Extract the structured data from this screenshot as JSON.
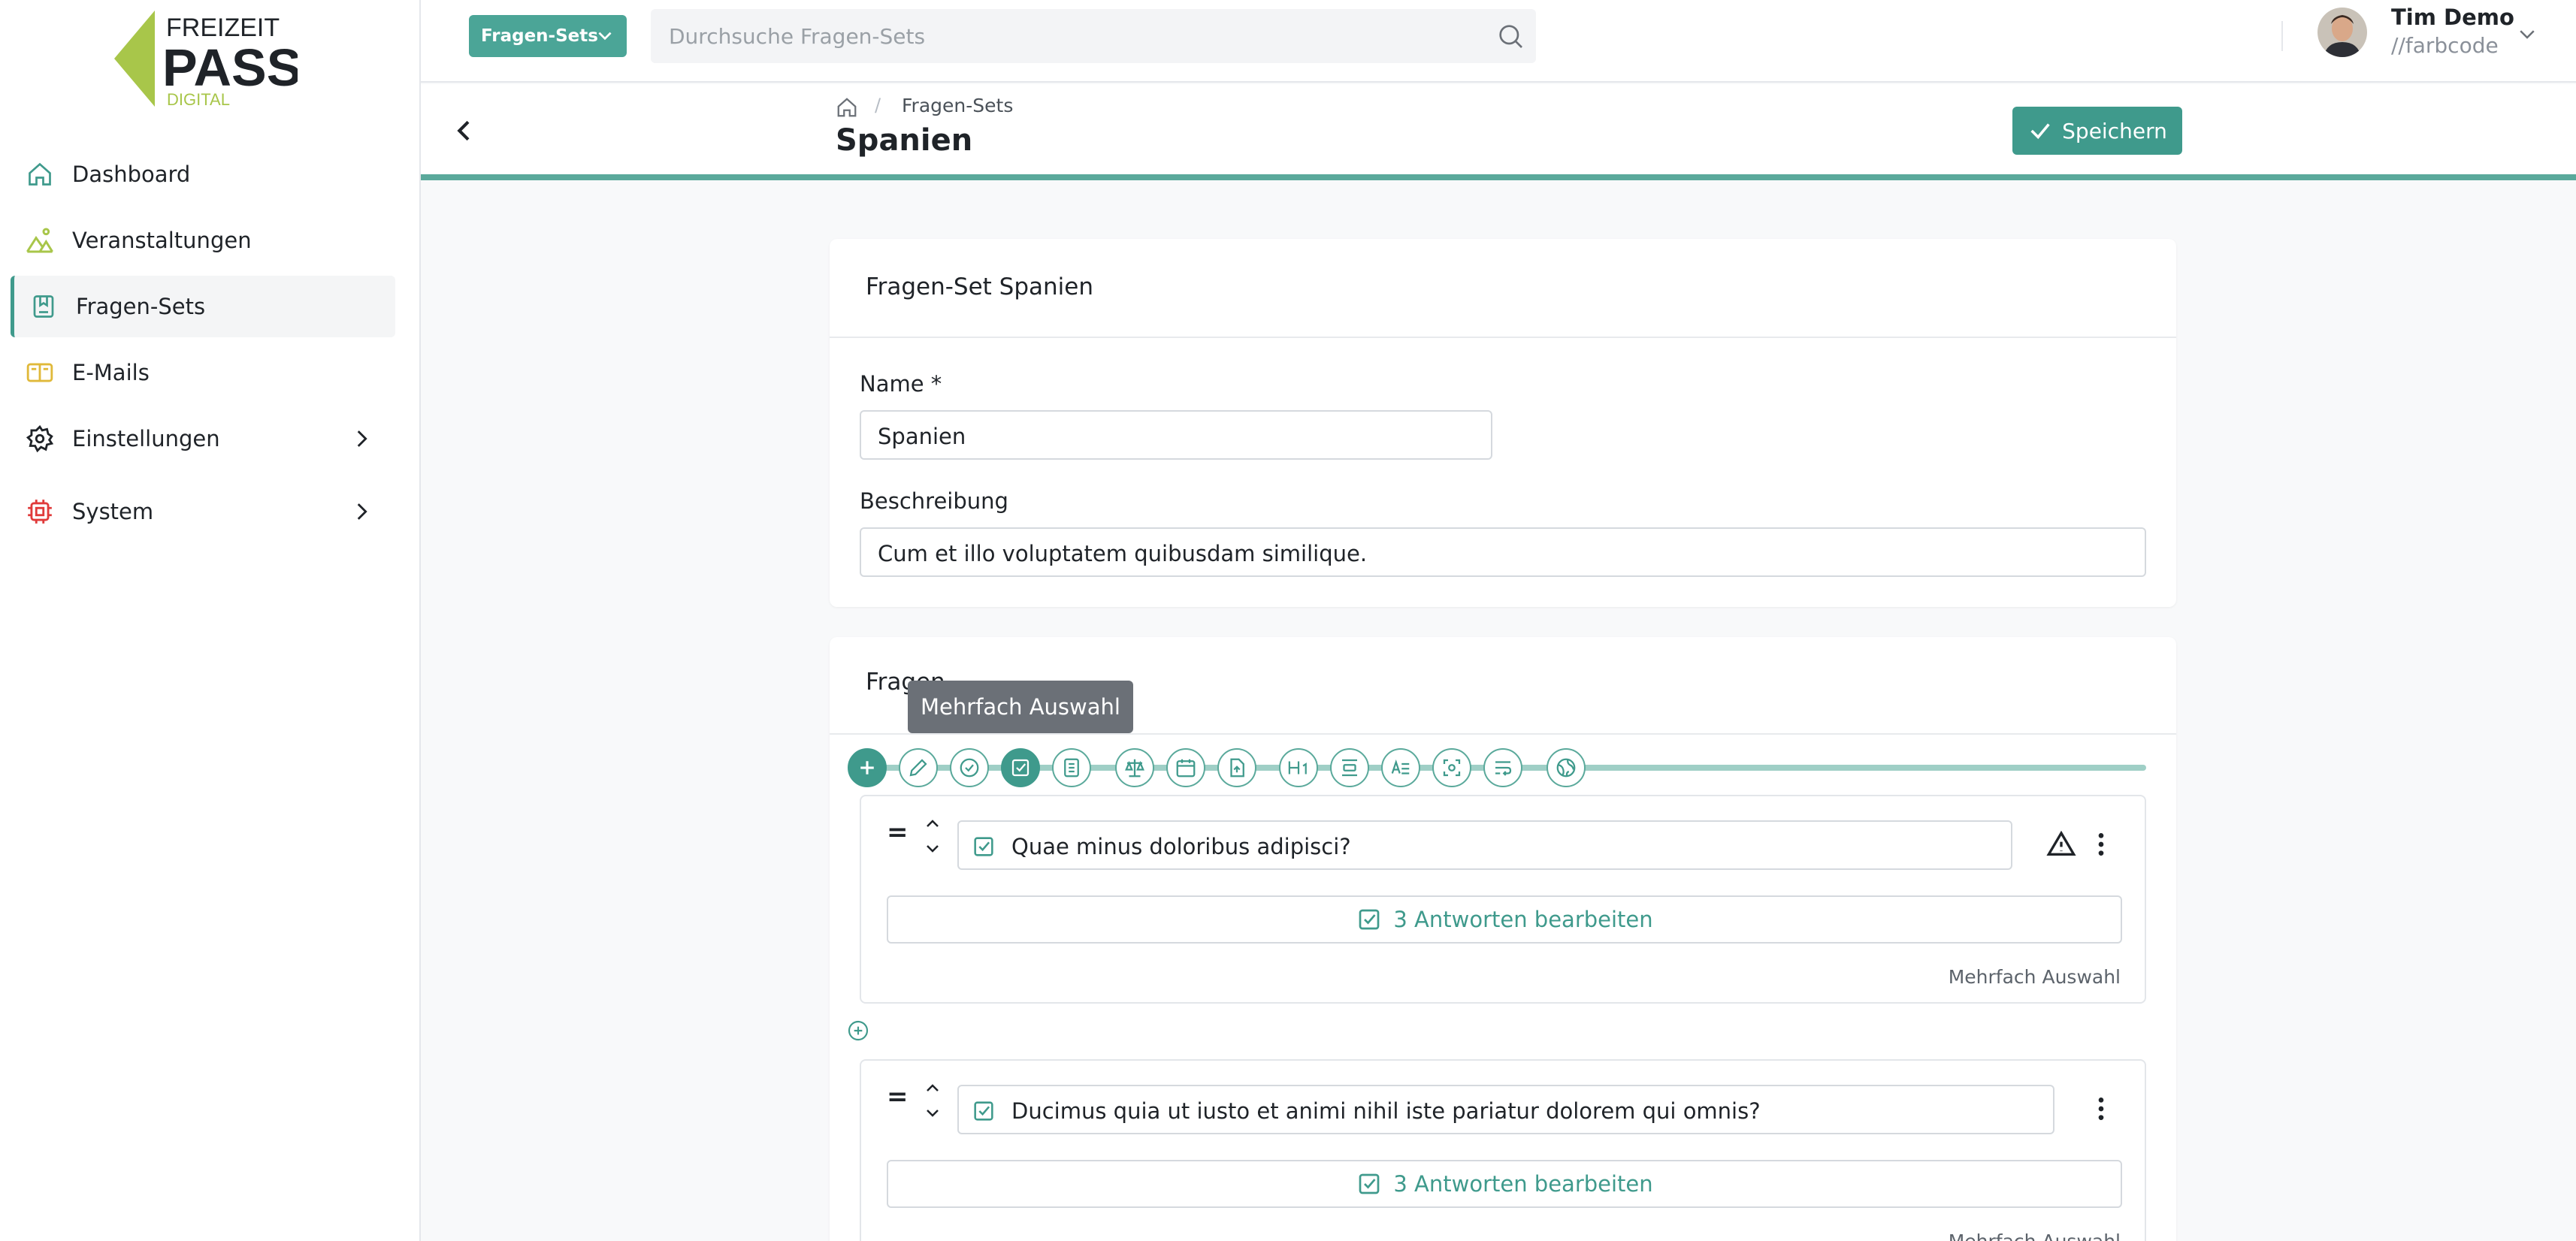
{
  "brand": {
    "logo_line1": "FREIZEIT",
    "logo_line2": "PASS",
    "logo_line3": "DIGITAL",
    "colors": {
      "accent": "#3f9a8c",
      "logo_green": "#a8c64a",
      "warning_red": "#e03a3a",
      "email_yellow": "#e0b93a"
    }
  },
  "sidebar": {
    "items": [
      {
        "label": "Dashboard",
        "icon": "home-icon"
      },
      {
        "label": "Veranstaltungen",
        "icon": "event-icon"
      },
      {
        "label": "Fragen-Sets",
        "icon": "bookmark-book-icon",
        "active": true
      },
      {
        "label": "E-Mails",
        "icon": "mail-icon"
      },
      {
        "label": "Einstellungen",
        "icon": "gear-icon",
        "has_submenu": true
      },
      {
        "label": "System",
        "icon": "chip-icon",
        "has_submenu": true
      }
    ]
  },
  "topbar": {
    "section_dropdown": "Fragen-Sets",
    "search_placeholder": "Durchsuche Fragen-Sets",
    "user": {
      "name": "Tim Demo",
      "org": "//farbcode"
    }
  },
  "header": {
    "breadcrumb": [
      "home",
      "Fragen-Sets"
    ],
    "title": "Spanien",
    "save_label": "Speichern"
  },
  "form_card": {
    "title": "Fragen-Set Spanien",
    "name_label": "Name *",
    "name_value": "Spanien",
    "desc_label": "Beschreibung",
    "desc_value": "Cum et illo voluptatem quibusdam similique."
  },
  "questions_card": {
    "title": "Fragen",
    "tooltip": "Mehrfach Auswahl",
    "toolbar_icons": [
      "plus-icon",
      "pencil-icon",
      "check-circle-icon",
      "checkbox-icon",
      "list-icon",
      "scale-icon",
      "calendar-icon",
      "file-upload-icon",
      "heading-icon",
      "align-center-icon",
      "text-lines-icon",
      "scan-icon",
      "wrap-text-icon",
      "globe-icon"
    ],
    "questions": [
      {
        "text": "Quae minus doloribus adipisci?",
        "answers": "3 Antworten bearbeiten",
        "type": "Mehrfach Auswahl",
        "warning": true
      },
      {
        "text": "Ducimus quia ut iusto et animi nihil iste pariatur dolorem qui omnis?",
        "answers": "3 Antworten bearbeiten",
        "type": "Mehrfach Auswahl",
        "warning": false
      }
    ]
  }
}
